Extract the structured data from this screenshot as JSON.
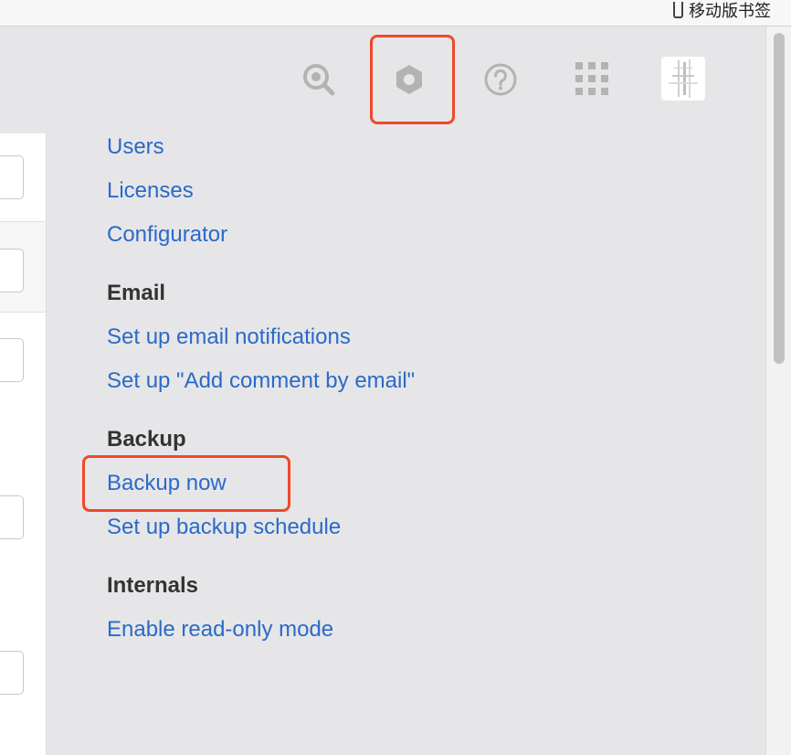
{
  "browser": {
    "bookmark_label": "移动版书签"
  },
  "toolbar": {
    "search_icon": "search-icon",
    "settings_icon": "gear-icon",
    "help_icon": "help-icon",
    "apps_icon": "app-grid-icon",
    "avatar": "avatar"
  },
  "menu": {
    "links_top": [
      "Users",
      "Licenses",
      "Configurator"
    ],
    "email": {
      "heading": "Email",
      "links": [
        "Set up email notifications",
        "Set up \"Add comment by email\""
      ]
    },
    "backup": {
      "heading": "Backup",
      "links": [
        "Backup now",
        "Set up backup schedule"
      ]
    },
    "internals": {
      "heading": "Internals",
      "links": [
        "Enable read-only mode"
      ]
    }
  },
  "colors": {
    "link": "#2a6ac8",
    "heading": "#333333",
    "highlight": "#f0482a",
    "icon": "#b3b3b3"
  }
}
